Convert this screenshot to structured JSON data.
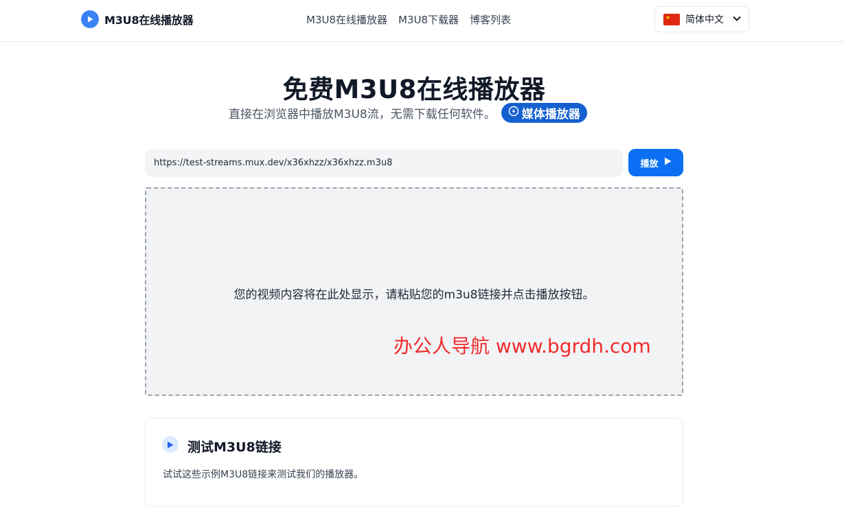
{
  "header": {
    "brand": "M3U8在线播放器",
    "nav": [
      "M3U8在线播放器",
      "M3U8下载器",
      "博客列表"
    ],
    "language": "简体中文"
  },
  "hero": {
    "title": "免费M3U8在线播放器",
    "subtitle": "直接在浏览器中播放M3U8流，无需下载任何软件。",
    "badge": "媒体播放器"
  },
  "player": {
    "url_value": "https://test-streams.mux.dev/x36xhzz/x36xhzz.m3u8",
    "play_label": "播放",
    "placeholder_text": "您的视频内容将在此处显示，请粘贴您的m3u8链接并点击播放按钮。",
    "watermark": "办公人导航  www.bgrdh.com"
  },
  "test_links": {
    "title": "测试M3U8链接",
    "description": "试试这些示例M3U8链接来测试我们的播放器。"
  },
  "colors": {
    "primary": "#0a6ff2",
    "badge": "#1560d1",
    "watermark": "#ef2b2b"
  }
}
